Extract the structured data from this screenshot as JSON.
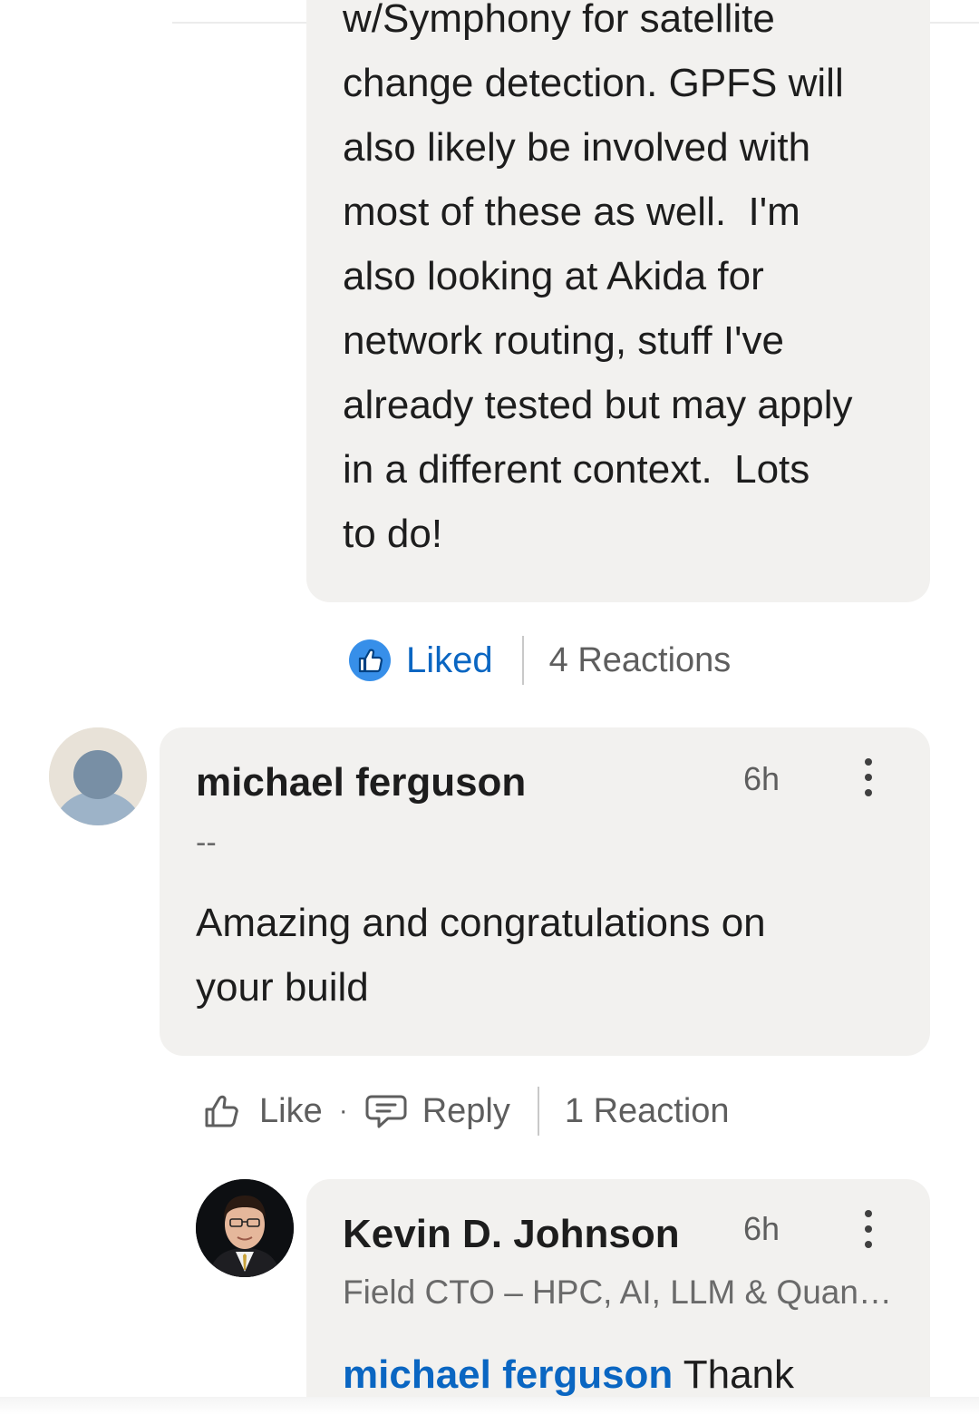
{
  "comment_1": {
    "clipped_top_line": "w/Symphony for satellite",
    "body": "change detection. GPFS will also likely be involved with most of these as well.  I'm also looking at Akida for network routing, stuff I've already tested but may apply in a different context.  Lots to do!",
    "body_lines": [
      "change detection. GPFS will",
      "also likely be involved with",
      "most of these as well.  I'm",
      "also looking at Akida for",
      "network routing, stuff I've",
      "already tested but may apply",
      "in a different context.  Lots",
      "to do!"
    ],
    "actions": {
      "liked_label": "Liked",
      "reactions_label": "4 Reactions"
    }
  },
  "comment_2": {
    "author": "michael ferguson",
    "time": "6h",
    "headline": "--",
    "body_lines": [
      "Amazing and congratulations on",
      "your build"
    ],
    "actions": {
      "like_label": "Like",
      "separator": "·",
      "reply_label": "Reply",
      "reactions_label": "1 Reaction"
    }
  },
  "comment_3": {
    "author": "Kevin D. Johnson",
    "time": "6h",
    "headline": "Field CTO – HPC, AI, LLM & Quantum Computing",
    "mention": "michael ferguson",
    "body_start": " Thank"
  },
  "icons": {
    "liked": "thumbs-up-filled-icon",
    "like": "thumbs-up-outline-icon",
    "reply": "speech-bubble-icon",
    "more": "vertical-ellipsis-icon"
  },
  "colors": {
    "accent": "#0a66c2",
    "bubble": "#f2f1ef",
    "muted_text": "#5e5e5e"
  }
}
